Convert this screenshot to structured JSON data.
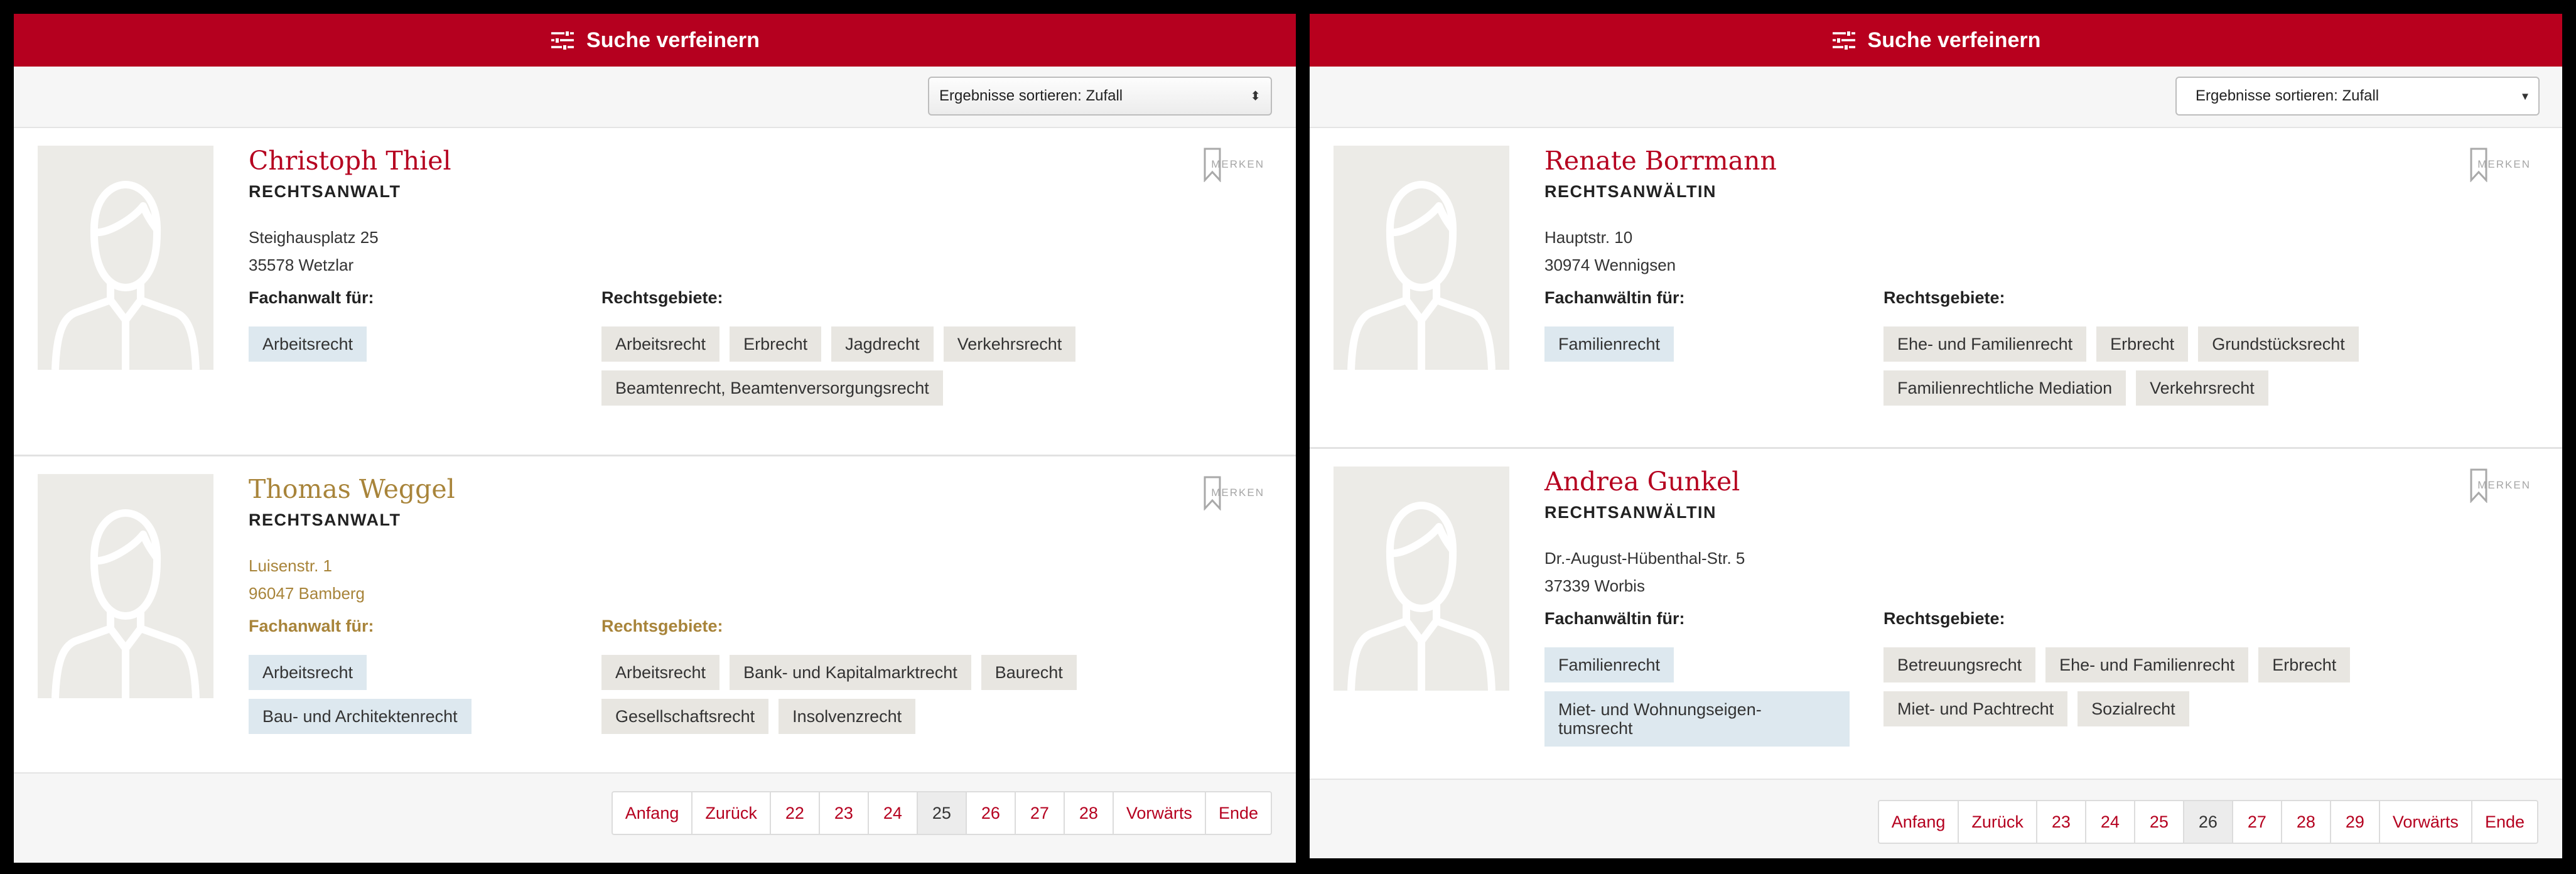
{
  "colors": {
    "header_left": "#b5001f",
    "header_right": "#b8001e",
    "accent": "#b5001f",
    "muted_gold": "#a8843a",
    "chip_gray": "#e8e6e1",
    "chip_blue": "#dde8ef"
  },
  "left": {
    "header": {
      "label": "Suche verfeinern",
      "icon": "sliders-icon"
    },
    "sort": {
      "label": "Ergebnisse sortieren: Zufall"
    },
    "entries": [
      {
        "name": "Christoph Thiel",
        "title": "RECHTSANWALT",
        "address": [
          "Steighausplatz 25",
          "35578 Wetzlar"
        ],
        "fach_label": "Fachanwalt für:",
        "fach": [
          "Arbeitsrecht"
        ],
        "gebiete_label": "Rechtsgebiete:",
        "gebiete": [
          "Arbeitsrecht",
          "Erbrecht",
          "Jagdrecht",
          "Verkehrsrecht",
          "Beamtenrecht, Beamtenversorgungsrecht"
        ],
        "merken": "MERKEN"
      },
      {
        "name": "Thomas Weggel",
        "title": "RECHTSANWALT",
        "address": [
          "Luisenstr. 1",
          "96047 Bamberg"
        ],
        "fach_label": "Fachanwalt für:",
        "fach": [
          "Arbeitsrecht",
          "Bau- und Architektenrecht"
        ],
        "gebiete_label": "Rechtsgebiete:",
        "gebiete": [
          "Arbeitsrecht",
          "Bank- und Kapitalmarktrecht",
          "Baurecht",
          "Gesellschaftsrecht",
          "Insolvenzrecht"
        ],
        "merken": "MERKEN"
      }
    ],
    "pagination": {
      "first": "Anfang",
      "prev": "Zurück",
      "pages": [
        "22",
        "23",
        "24",
        "25",
        "26",
        "27",
        "28"
      ],
      "current": "25",
      "next": "Vorwärts",
      "last": "Ende"
    }
  },
  "right": {
    "header": {
      "label": "Suche verfeinern",
      "icon": "sliders-icon"
    },
    "sort": {
      "label": "Ergebnisse sortieren: Zufall"
    },
    "entries": [
      {
        "name": "Renate Borrmann",
        "title": "RECHTSANWÄLTIN",
        "address": [
          "Hauptstr. 10",
          "30974 Wennigsen"
        ],
        "fach_label": "Fachanwältin für:",
        "fach": [
          "Familienrecht"
        ],
        "gebiete_label": "Rechtsgebiete:",
        "gebiete": [
          "Ehe- und Familienrecht",
          "Erbrecht",
          "Grundstücksrecht",
          "Familienrechtliche Mediation",
          "Verkehrsrecht"
        ],
        "merken": "MERKEN"
      },
      {
        "name": "Andrea Gunkel",
        "title": "RECHTSANWÄLTIN",
        "address": [
          "Dr.-August-Hübenthal-Str. 5",
          "37339 Worbis"
        ],
        "fach_label": "Fachanwältin für:",
        "fach": [
          "Familienrecht",
          "Miet- und Wohnungseigen-tumsrecht"
        ],
        "gebiete_label": "Rechtsgebiete:",
        "gebiete": [
          "Betreuungsrecht",
          "Ehe- und Familienrecht",
          "Erbrecht",
          "Miet- und Pachtrecht",
          "Sozialrecht"
        ],
        "merken": "MERKEN"
      }
    ],
    "pagination": {
      "first": "Anfang",
      "prev": "Zurück",
      "pages": [
        "23",
        "24",
        "25",
        "26",
        "27",
        "28",
        "29"
      ],
      "current": "26",
      "next": "Vorwärts",
      "last": "Ende"
    }
  }
}
